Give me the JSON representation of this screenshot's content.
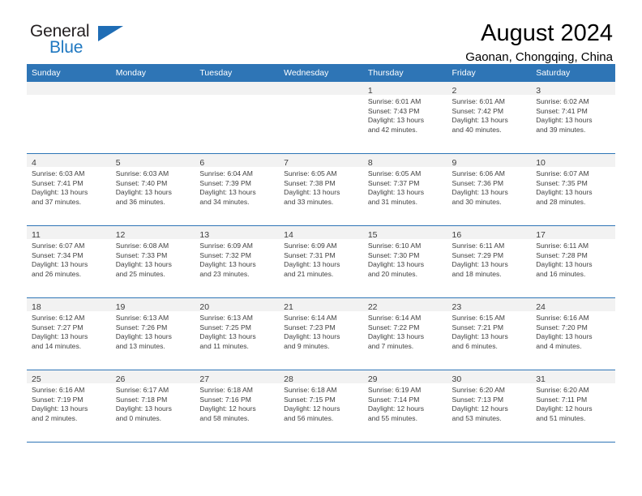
{
  "brand": {
    "name_part1": "General",
    "name_part2": "Blue",
    "triangle_color": "#1f6db5",
    "blue_text_color": "#1f78c1"
  },
  "header": {
    "title": "August 2024",
    "subtitle": "Gaonan, Chongqing, China"
  },
  "theme": {
    "header_bg": "#2e75b6",
    "header_text": "#ffffff",
    "daynum_band_bg": "#f2f2f2",
    "row_divider": "#2e75b6"
  },
  "weekdays": [
    "Sunday",
    "Monday",
    "Tuesday",
    "Wednesday",
    "Thursday",
    "Friday",
    "Saturday"
  ],
  "weeks": [
    [
      {
        "day": "",
        "sunrise": "",
        "sunset": "",
        "daylight1": "",
        "daylight2": "",
        "empty": true
      },
      {
        "day": "",
        "sunrise": "",
        "sunset": "",
        "daylight1": "",
        "daylight2": "",
        "empty": true
      },
      {
        "day": "",
        "sunrise": "",
        "sunset": "",
        "daylight1": "",
        "daylight2": "",
        "empty": true
      },
      {
        "day": "",
        "sunrise": "",
        "sunset": "",
        "daylight1": "",
        "daylight2": "",
        "empty": true
      },
      {
        "day": "1",
        "sunrise": "Sunrise: 6:01 AM",
        "sunset": "Sunset: 7:43 PM",
        "daylight1": "Daylight: 13 hours",
        "daylight2": "and 42 minutes.",
        "empty": false
      },
      {
        "day": "2",
        "sunrise": "Sunrise: 6:01 AM",
        "sunset": "Sunset: 7:42 PM",
        "daylight1": "Daylight: 13 hours",
        "daylight2": "and 40 minutes.",
        "empty": false
      },
      {
        "day": "3",
        "sunrise": "Sunrise: 6:02 AM",
        "sunset": "Sunset: 7:41 PM",
        "daylight1": "Daylight: 13 hours",
        "daylight2": "and 39 minutes.",
        "empty": false
      }
    ],
    [
      {
        "day": "4",
        "sunrise": "Sunrise: 6:03 AM",
        "sunset": "Sunset: 7:41 PM",
        "daylight1": "Daylight: 13 hours",
        "daylight2": "and 37 minutes.",
        "empty": false
      },
      {
        "day": "5",
        "sunrise": "Sunrise: 6:03 AM",
        "sunset": "Sunset: 7:40 PM",
        "daylight1": "Daylight: 13 hours",
        "daylight2": "and 36 minutes.",
        "empty": false
      },
      {
        "day": "6",
        "sunrise": "Sunrise: 6:04 AM",
        "sunset": "Sunset: 7:39 PM",
        "daylight1": "Daylight: 13 hours",
        "daylight2": "and 34 minutes.",
        "empty": false
      },
      {
        "day": "7",
        "sunrise": "Sunrise: 6:05 AM",
        "sunset": "Sunset: 7:38 PM",
        "daylight1": "Daylight: 13 hours",
        "daylight2": "and 33 minutes.",
        "empty": false
      },
      {
        "day": "8",
        "sunrise": "Sunrise: 6:05 AM",
        "sunset": "Sunset: 7:37 PM",
        "daylight1": "Daylight: 13 hours",
        "daylight2": "and 31 minutes.",
        "empty": false
      },
      {
        "day": "9",
        "sunrise": "Sunrise: 6:06 AM",
        "sunset": "Sunset: 7:36 PM",
        "daylight1": "Daylight: 13 hours",
        "daylight2": "and 30 minutes.",
        "empty": false
      },
      {
        "day": "10",
        "sunrise": "Sunrise: 6:07 AM",
        "sunset": "Sunset: 7:35 PM",
        "daylight1": "Daylight: 13 hours",
        "daylight2": "and 28 minutes.",
        "empty": false
      }
    ],
    [
      {
        "day": "11",
        "sunrise": "Sunrise: 6:07 AM",
        "sunset": "Sunset: 7:34 PM",
        "daylight1": "Daylight: 13 hours",
        "daylight2": "and 26 minutes.",
        "empty": false
      },
      {
        "day": "12",
        "sunrise": "Sunrise: 6:08 AM",
        "sunset": "Sunset: 7:33 PM",
        "daylight1": "Daylight: 13 hours",
        "daylight2": "and 25 minutes.",
        "empty": false
      },
      {
        "day": "13",
        "sunrise": "Sunrise: 6:09 AM",
        "sunset": "Sunset: 7:32 PM",
        "daylight1": "Daylight: 13 hours",
        "daylight2": "and 23 minutes.",
        "empty": false
      },
      {
        "day": "14",
        "sunrise": "Sunrise: 6:09 AM",
        "sunset": "Sunset: 7:31 PM",
        "daylight1": "Daylight: 13 hours",
        "daylight2": "and 21 minutes.",
        "empty": false
      },
      {
        "day": "15",
        "sunrise": "Sunrise: 6:10 AM",
        "sunset": "Sunset: 7:30 PM",
        "daylight1": "Daylight: 13 hours",
        "daylight2": "and 20 minutes.",
        "empty": false
      },
      {
        "day": "16",
        "sunrise": "Sunrise: 6:11 AM",
        "sunset": "Sunset: 7:29 PM",
        "daylight1": "Daylight: 13 hours",
        "daylight2": "and 18 minutes.",
        "empty": false
      },
      {
        "day": "17",
        "sunrise": "Sunrise: 6:11 AM",
        "sunset": "Sunset: 7:28 PM",
        "daylight1": "Daylight: 13 hours",
        "daylight2": "and 16 minutes.",
        "empty": false
      }
    ],
    [
      {
        "day": "18",
        "sunrise": "Sunrise: 6:12 AM",
        "sunset": "Sunset: 7:27 PM",
        "daylight1": "Daylight: 13 hours",
        "daylight2": "and 14 minutes.",
        "empty": false
      },
      {
        "day": "19",
        "sunrise": "Sunrise: 6:13 AM",
        "sunset": "Sunset: 7:26 PM",
        "daylight1": "Daylight: 13 hours",
        "daylight2": "and 13 minutes.",
        "empty": false
      },
      {
        "day": "20",
        "sunrise": "Sunrise: 6:13 AM",
        "sunset": "Sunset: 7:25 PM",
        "daylight1": "Daylight: 13 hours",
        "daylight2": "and 11 minutes.",
        "empty": false
      },
      {
        "day": "21",
        "sunrise": "Sunrise: 6:14 AM",
        "sunset": "Sunset: 7:23 PM",
        "daylight1": "Daylight: 13 hours",
        "daylight2": "and 9 minutes.",
        "empty": false
      },
      {
        "day": "22",
        "sunrise": "Sunrise: 6:14 AM",
        "sunset": "Sunset: 7:22 PM",
        "daylight1": "Daylight: 13 hours",
        "daylight2": "and 7 minutes.",
        "empty": false
      },
      {
        "day": "23",
        "sunrise": "Sunrise: 6:15 AM",
        "sunset": "Sunset: 7:21 PM",
        "daylight1": "Daylight: 13 hours",
        "daylight2": "and 6 minutes.",
        "empty": false
      },
      {
        "day": "24",
        "sunrise": "Sunrise: 6:16 AM",
        "sunset": "Sunset: 7:20 PM",
        "daylight1": "Daylight: 13 hours",
        "daylight2": "and 4 minutes.",
        "empty": false
      }
    ],
    [
      {
        "day": "25",
        "sunrise": "Sunrise: 6:16 AM",
        "sunset": "Sunset: 7:19 PM",
        "daylight1": "Daylight: 13 hours",
        "daylight2": "and 2 minutes.",
        "empty": false
      },
      {
        "day": "26",
        "sunrise": "Sunrise: 6:17 AM",
        "sunset": "Sunset: 7:18 PM",
        "daylight1": "Daylight: 13 hours",
        "daylight2": "and 0 minutes.",
        "empty": false
      },
      {
        "day": "27",
        "sunrise": "Sunrise: 6:18 AM",
        "sunset": "Sunset: 7:16 PM",
        "daylight1": "Daylight: 12 hours",
        "daylight2": "and 58 minutes.",
        "empty": false
      },
      {
        "day": "28",
        "sunrise": "Sunrise: 6:18 AM",
        "sunset": "Sunset: 7:15 PM",
        "daylight1": "Daylight: 12 hours",
        "daylight2": "and 56 minutes.",
        "empty": false
      },
      {
        "day": "29",
        "sunrise": "Sunrise: 6:19 AM",
        "sunset": "Sunset: 7:14 PM",
        "daylight1": "Daylight: 12 hours",
        "daylight2": "and 55 minutes.",
        "empty": false
      },
      {
        "day": "30",
        "sunrise": "Sunrise: 6:20 AM",
        "sunset": "Sunset: 7:13 PM",
        "daylight1": "Daylight: 12 hours",
        "daylight2": "and 53 minutes.",
        "empty": false
      },
      {
        "day": "31",
        "sunrise": "Sunrise: 6:20 AM",
        "sunset": "Sunset: 7:11 PM",
        "daylight1": "Daylight: 12 hours",
        "daylight2": "and 51 minutes.",
        "empty": false
      }
    ]
  ]
}
